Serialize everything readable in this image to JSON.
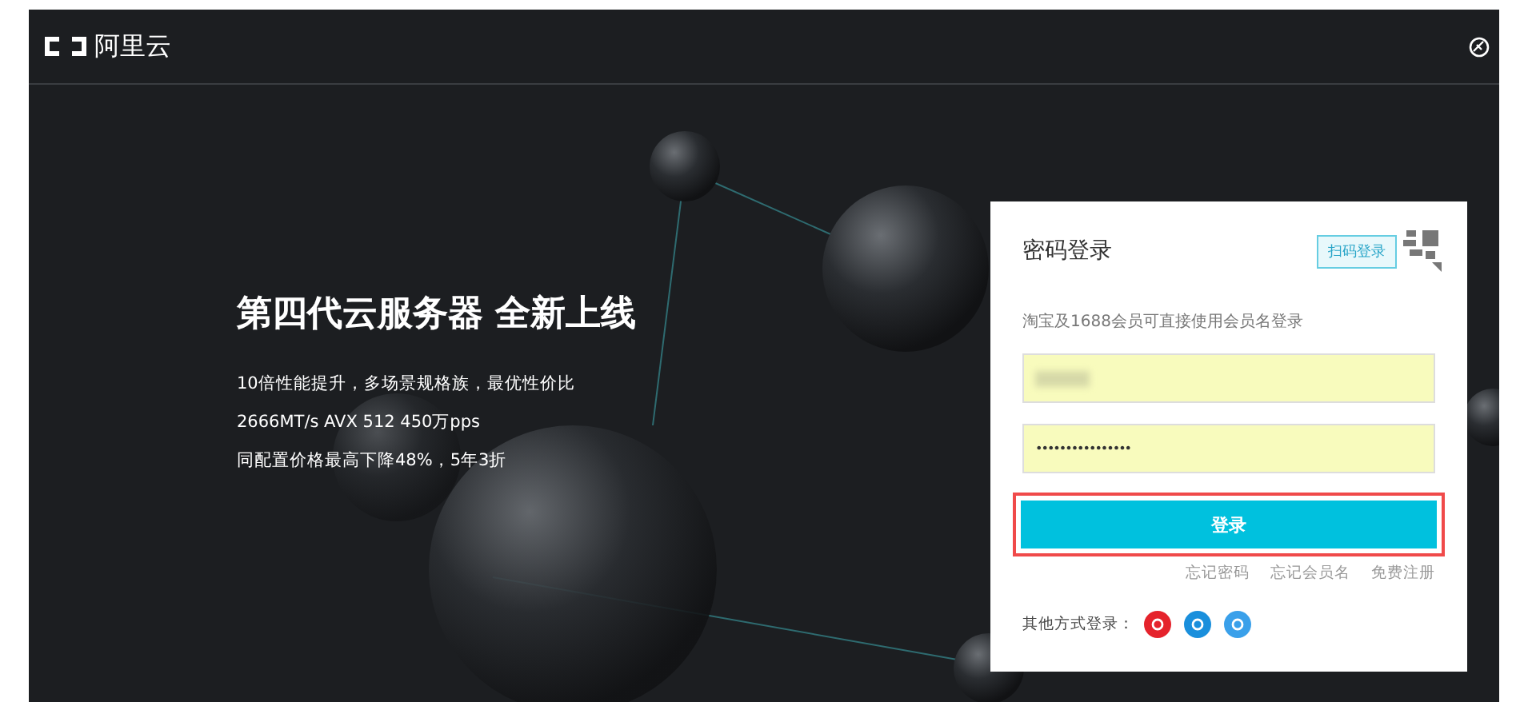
{
  "header": {
    "logo_text": "阿里云"
  },
  "promo": {
    "title": "第四代云服务器 全新上线",
    "lines": [
      "10倍性能提升，多场景规格族，最优性价比",
      "2666MT/s AVX 512 450万pps",
      "同配置价格最高下降48%，5年3折"
    ]
  },
  "login": {
    "title": "密码登录",
    "qr_tab": "扫码登录",
    "hint": "淘宝及1688会员可直接使用会员名登录",
    "fields": [
      {
        "kind": "blurred"
      },
      {
        "kind": "password",
        "value": "••••••••••••••••"
      }
    ],
    "submit": {
      "label": "登录",
      "highlighted": true
    },
    "links": [
      "忘记密码",
      "忘记会员名",
      "免费注册"
    ],
    "other_label": "其他方式登录：",
    "other_methods": [
      {
        "color": "#e5232c"
      },
      {
        "color": "#1a8fdc"
      },
      {
        "color": "#3aa0ea"
      }
    ]
  }
}
